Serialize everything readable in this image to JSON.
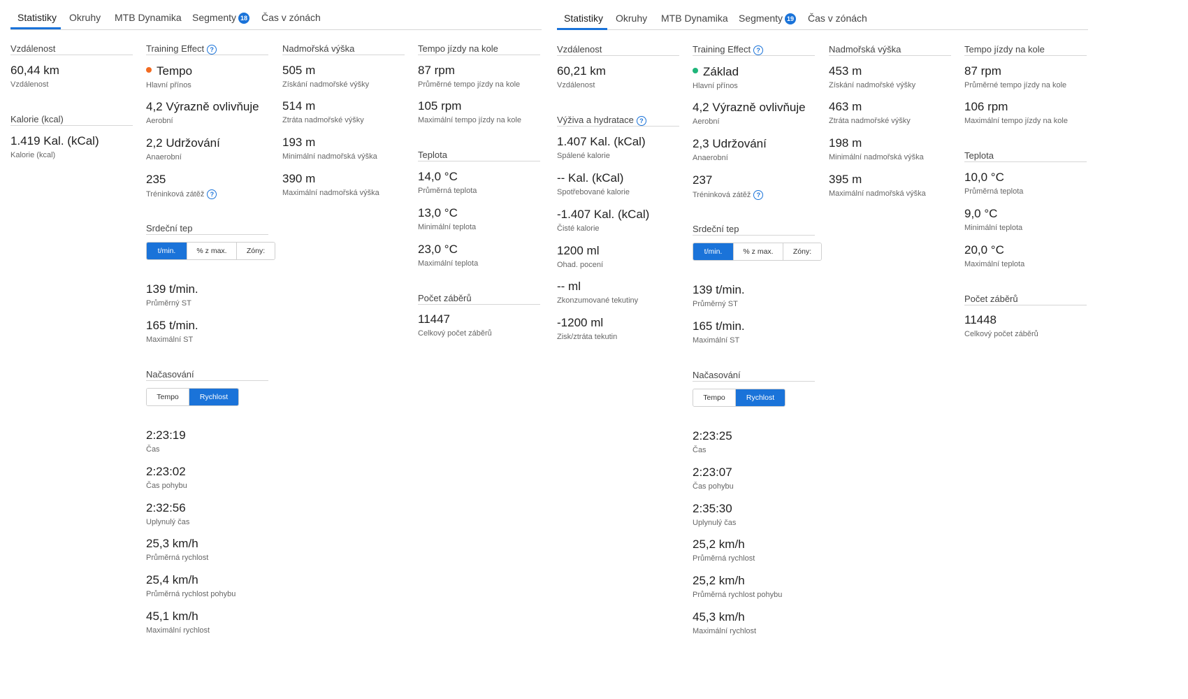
{
  "colors": {
    "accent": "#1a73d9",
    "tempo_dot": "#f26b21",
    "zaklad_dot": "#1fb57a"
  },
  "panels": [
    {
      "tabs": {
        "t0": "Statistiky",
        "t1": "Okruhy",
        "t2": "MTB Dynamika",
        "t3": "Segmenty",
        "t3_badge": "18",
        "t4": "Čas v zónách"
      },
      "c1": {
        "distance": {
          "title": "Vzdálenost",
          "value": "60,44 km",
          "label": "Vzdálenost"
        },
        "calories": {
          "title": "Kalorie (kcal)",
          "value": "1.419 Kal. (kCal)",
          "label": "Kalorie (kcal)"
        }
      },
      "c2": {
        "te_title": "Training Effect",
        "main": {
          "value": "Tempo",
          "label": "Hlavní přínos"
        },
        "aerobic": {
          "value": "4,2 Výrazně ovlivňuje",
          "label": "Aerobní"
        },
        "anaerobic": {
          "value": "2,2 Udržování",
          "label": "Anaerobní"
        },
        "load": {
          "value": "235",
          "label": "Tréninková zátěž"
        },
        "hr_title": "Srdeční tep",
        "hr_seg": {
          "o1": "t/min.",
          "o2": "% z max.",
          "o3": "Zóny:"
        },
        "hr_avg": {
          "value": "139 t/min.",
          "label": "Průměrný ST"
        },
        "hr_max": {
          "value": "165 t/min.",
          "label": "Maximální ST"
        },
        "timing_title": "Načasování",
        "timing_seg": {
          "o1": "Tempo",
          "o2": "Rychlost"
        },
        "time": {
          "value": "2:23:19",
          "label": "Čas"
        },
        "moving": {
          "value": "2:23:02",
          "label": "Čas pohybu"
        },
        "elapsed": {
          "value": "2:32:56",
          "label": "Uplynulý čas"
        },
        "avg_speed": {
          "value": "25,3 km/h",
          "label": "Průměrná rychlost"
        },
        "avg_moving_speed": {
          "value": "25,4 km/h",
          "label": "Průměrná rychlost pohybu"
        },
        "max_speed": {
          "value": "45,1 km/h",
          "label": "Maximální rychlost"
        }
      },
      "c3": {
        "title": "Nadmořská výška",
        "gain": {
          "value": "505 m",
          "label": "Získání nadmořské výšky"
        },
        "loss": {
          "value": "514 m",
          "label": "Ztráta nadmořské výšky"
        },
        "min": {
          "value": "193 m",
          "label": "Minimální nadmořská výška"
        },
        "max": {
          "value": "390 m",
          "label": "Maximální nadmořská výška"
        }
      },
      "c4": {
        "cadence_title": "Tempo jízdy na kole",
        "cad_avg": {
          "value": "87 rpm",
          "label": "Průměrné tempo jízdy na kole"
        },
        "cad_max": {
          "value": "105 rpm",
          "label": "Maximální tempo jízdy na kole"
        },
        "temp_title": "Teplota",
        "t_avg": {
          "value": "14,0 °C",
          "label": "Průměrná teplota"
        },
        "t_min": {
          "value": "13,0 °C",
          "label": "Minimální teplota"
        },
        "t_max": {
          "value": "23,0 °C",
          "label": "Maximální teplota"
        },
        "strokes_title": "Počet záběrů",
        "strokes": {
          "value": "11447",
          "label": "Celkový počet záběrů"
        }
      }
    },
    {
      "tabs": {
        "t0": "Statistiky",
        "t1": "Okruhy",
        "t2": "MTB Dynamika",
        "t3": "Segmenty",
        "t3_badge": "19",
        "t4": "Čas v zónách"
      },
      "c1": {
        "distance": {
          "title": "Vzdálenost",
          "value": "60,21 km",
          "label": "Vzdálenost"
        },
        "nutrition_title": "Výživa a hydratace",
        "burned": {
          "value": "1.407 Kal. (kCal)",
          "label": "Spálené kalorie"
        },
        "consumed": {
          "value": "-- Kal. (kCal)",
          "label": "Spotřebované kalorie"
        },
        "net": {
          "value": "-1.407 Kal. (kCal)",
          "label": "Čisté kalorie"
        },
        "sweat": {
          "value": "1200 ml",
          "label": "Ohad. pocení"
        },
        "fluids": {
          "value": "-- ml",
          "label": "Zkonzumované tekutiny"
        },
        "fluid_net": {
          "value": "-1200 ml",
          "label": "Zisk/ztráta tekutin"
        }
      },
      "c2": {
        "te_title": "Training Effect",
        "main": {
          "value": "Základ",
          "label": "Hlavní přínos"
        },
        "aerobic": {
          "value": "4,2 Výrazně ovlivňuje",
          "label": "Aerobní"
        },
        "anaerobic": {
          "value": "2,3 Udržování",
          "label": "Anaerobní"
        },
        "load": {
          "value": "237",
          "label": "Tréninková zátěž"
        },
        "hr_title": "Srdeční tep",
        "hr_seg": {
          "o1": "t/min.",
          "o2": "% z max.",
          "o3": "Zóny:"
        },
        "hr_avg": {
          "value": "139 t/min.",
          "label": "Průměrný ST"
        },
        "hr_max": {
          "value": "165 t/min.",
          "label": "Maximální ST"
        },
        "timing_title": "Načasování",
        "timing_seg": {
          "o1": "Tempo",
          "o2": "Rychlost"
        },
        "time": {
          "value": "2:23:25",
          "label": "Čas"
        },
        "moving": {
          "value": "2:23:07",
          "label": "Čas pohybu"
        },
        "elapsed": {
          "value": "2:35:30",
          "label": "Uplynulý čas"
        },
        "avg_speed": {
          "value": "25,2 km/h",
          "label": "Průměrná rychlost"
        },
        "avg_moving_speed": {
          "value": "25,2 km/h",
          "label": "Průměrná rychlost pohybu"
        },
        "max_speed": {
          "value": "45,3 km/h",
          "label": "Maximální rychlost"
        }
      },
      "c3": {
        "title": "Nadmořská výška",
        "gain": {
          "value": "453 m",
          "label": "Získání nadmořské výšky"
        },
        "loss": {
          "value": "463 m",
          "label": "Ztráta nadmořské výšky"
        },
        "min": {
          "value": "198 m",
          "label": "Minimální nadmořská výška"
        },
        "max": {
          "value": "395 m",
          "label": "Maximální nadmořská výška"
        }
      },
      "c4": {
        "cadence_title": "Tempo jízdy na kole",
        "cad_avg": {
          "value": "87 rpm",
          "label": "Průměrné tempo jízdy na kole"
        },
        "cad_max": {
          "value": "106 rpm",
          "label": "Maximální tempo jízdy na kole"
        },
        "temp_title": "Teplota",
        "t_avg": {
          "value": "10,0 °C",
          "label": "Průměrná teplota"
        },
        "t_min": {
          "value": "9,0 °C",
          "label": "Minimální teplota"
        },
        "t_max": {
          "value": "20,0 °C",
          "label": "Maximální teplota"
        },
        "strokes_title": "Počet záběrů",
        "strokes": {
          "value": "11448",
          "label": "Celkový počet záběrů"
        }
      }
    }
  ]
}
